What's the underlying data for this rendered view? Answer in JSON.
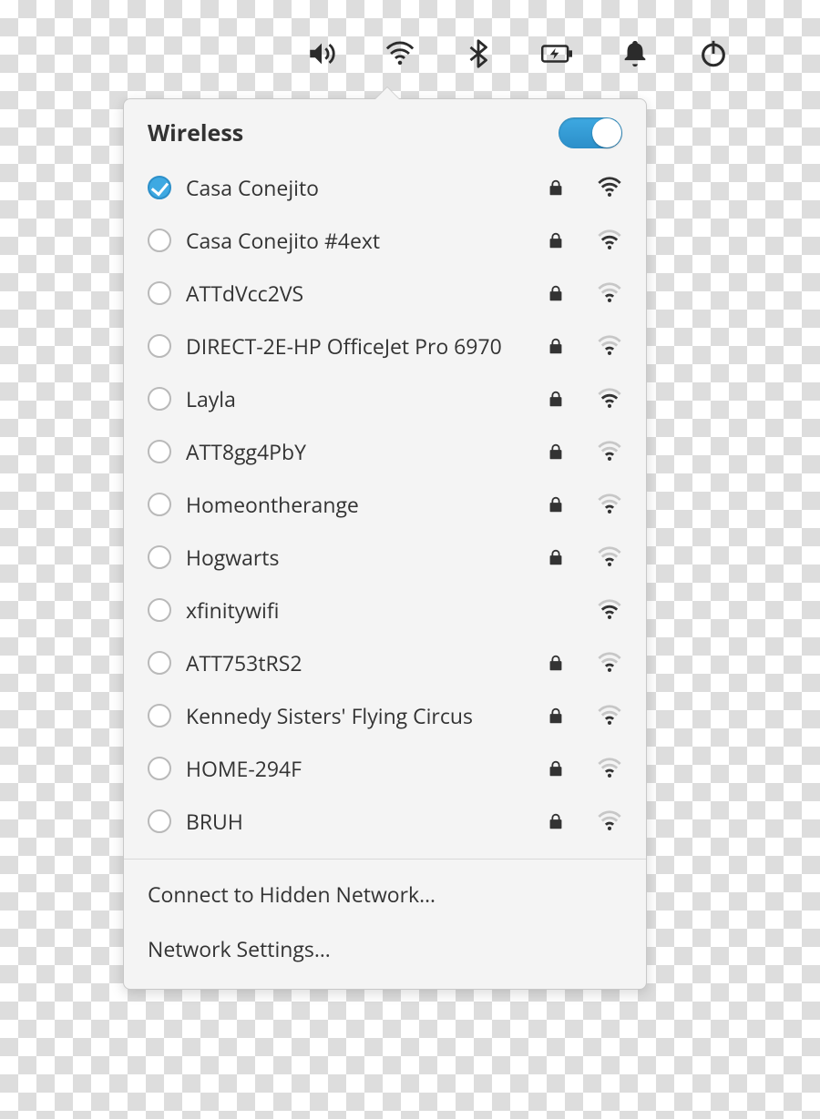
{
  "tray_icons": [
    "volume-icon",
    "wifi-icon",
    "bluetooth-icon",
    "battery-icon",
    "bell-icon",
    "power-icon"
  ],
  "header": {
    "title": "Wireless",
    "enabled": true
  },
  "networks": [
    {
      "ssid": "Casa Conejito",
      "secured": true,
      "signal": 4,
      "connected": true
    },
    {
      "ssid": "Casa Conejito #4ext",
      "secured": true,
      "signal": 3,
      "connected": false
    },
    {
      "ssid": "ATTdVcc2VS",
      "secured": true,
      "signal": 2,
      "connected": false
    },
    {
      "ssid": "DIRECT-2E-HP OfficeJet Pro 6970",
      "secured": true,
      "signal": 2,
      "connected": false
    },
    {
      "ssid": "Layla",
      "secured": true,
      "signal": 3,
      "connected": false
    },
    {
      "ssid": "ATT8gg4PbY",
      "secured": true,
      "signal": 2,
      "connected": false
    },
    {
      "ssid": "Homeontherange",
      "secured": true,
      "signal": 2,
      "connected": false
    },
    {
      "ssid": "Hogwarts",
      "secured": true,
      "signal": 2,
      "connected": false
    },
    {
      "ssid": "xfinitywifi",
      "secured": false,
      "signal": 3,
      "connected": false
    },
    {
      "ssid": "ATT753tRS2",
      "secured": true,
      "signal": 2,
      "connected": false
    },
    {
      "ssid": "Kennedy Sisters' Flying Circus",
      "secured": true,
      "signal": 2,
      "connected": false
    },
    {
      "ssid": "HOME-294F",
      "secured": true,
      "signal": 2,
      "connected": false
    },
    {
      "ssid": "BRUH",
      "secured": true,
      "signal": 2,
      "connected": false
    }
  ],
  "footer": {
    "hidden": "Connect to Hidden Network…",
    "settings": "Network Settings…"
  },
  "colors": {
    "accent": "#3ea9e2"
  }
}
